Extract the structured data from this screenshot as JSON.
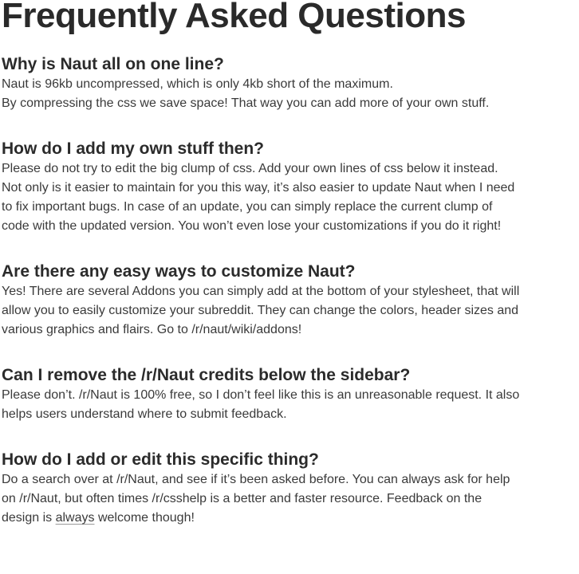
{
  "page": {
    "title": "Frequently Asked Questions"
  },
  "faqs": [
    {
      "question": "Why is Naut all on one line?",
      "lines": [
        "Naut is 96kb uncompressed, which is only 4kb short of the maximum.",
        "By compressing the css we save space! That way you can add more of your own stuff."
      ]
    },
    {
      "question": "How do I add my own stuff then?",
      "lines": [
        "Please do not try to edit the big clump of css. Add your own lines of css below it instead.",
        "Not only is it easier to maintain for you this way, it’s also easier to update Naut when I need",
        "to fix important bugs. In case of an update, you can simply replace the current clump of",
        "code with the updated version. You won’t even lose your customizations if you do it right!"
      ]
    },
    {
      "question": "Are there any easy ways to customize Naut?",
      "lines": [
        "Yes! There are several Addons you can simply add at the bottom of your stylesheet, that will",
        "allow you to easily customize your subreddit. They can change the colors, header sizes and",
        "various graphics and flairs. Go to /r/naut/wiki/addons!"
      ]
    },
    {
      "question": "Can I remove the /r/Naut credits below the sidebar?",
      "lines": [
        "Please don’t. /r/Naut is 100% free, so I don’t feel like this is an unreasonable request. It also",
        "helps users understand where to submit feedback."
      ]
    },
    {
      "question": "How do I add or edit this specific thing?",
      "lines": [
        "Do a search over at /r/Naut, and see if it’s been asked before. You can always ask for help",
        "on /r/Naut, but often times /r/csshelp is a better and faster resource. Feedback on the"
      ],
      "last_line": {
        "before": "design is ",
        "emphasis": "always",
        "after": " welcome though!"
      }
    }
  ]
}
